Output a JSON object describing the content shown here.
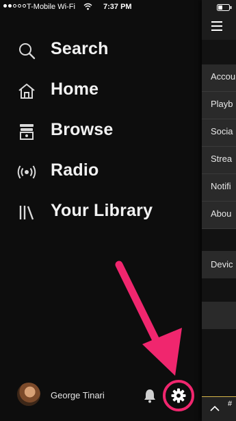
{
  "status_bar": {
    "carrier": "T-Mobile Wi-Fi",
    "time": "7:37 PM"
  },
  "menu": {
    "items": [
      {
        "label": "Search",
        "icon": "search-icon"
      },
      {
        "label": "Home",
        "icon": "home-icon"
      },
      {
        "label": "Browse",
        "icon": "browse-icon"
      },
      {
        "label": "Radio",
        "icon": "radio-icon"
      },
      {
        "label": "Your Library",
        "icon": "library-icon"
      }
    ]
  },
  "footer": {
    "username": "George Tinari",
    "bell_icon": "bell-icon",
    "settings_icon": "gear-icon"
  },
  "settings_panel": {
    "items": [
      "Accou",
      "Playb",
      "Socia",
      "Strea",
      "Notifi",
      "Abou"
    ],
    "devices_label": "Devic",
    "player_text": "#"
  },
  "colors": {
    "background": "#0d0d0d",
    "highlight": "#f0266e",
    "panel": "#2a2a2a"
  }
}
